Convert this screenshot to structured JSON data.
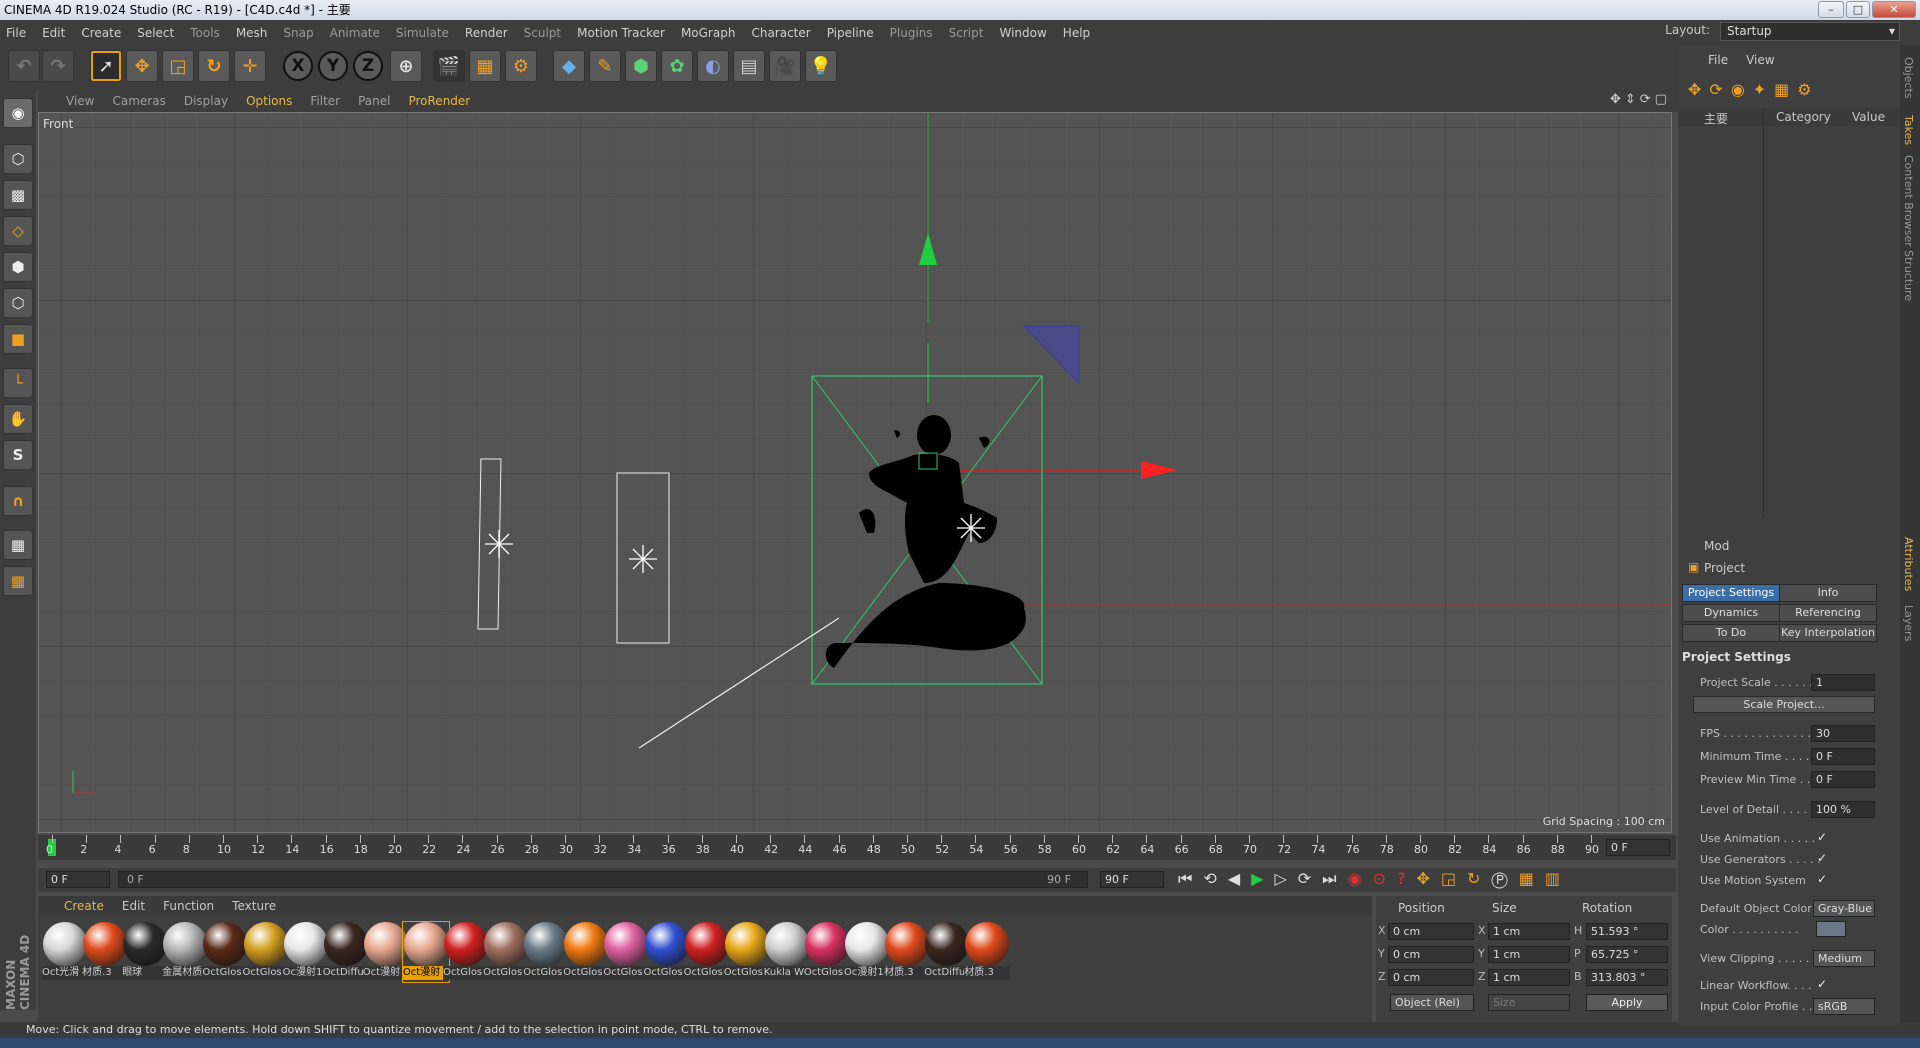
{
  "title": "CINEMA 4D R19.024 Studio (RC - R19) - [C4D.c4d *] - 主要",
  "menu": [
    "File",
    "Edit",
    "Create",
    "Select",
    "Tools",
    "Mesh",
    "Snap",
    "Animate",
    "Simulate",
    "Render",
    "Sculpt",
    "Motion Tracker",
    "MoGraph",
    "Character",
    "Pipeline",
    "Plugins",
    "Script",
    "Window",
    "Help"
  ],
  "layout": {
    "label": "Layout:",
    "value": "Startup"
  },
  "toolbar": {
    "axis_x": "X",
    "axis_y": "Y",
    "axis_z": "Z"
  },
  "viewport": {
    "menu": [
      "View",
      "Cameras",
      "Display",
      "Options",
      "Filter",
      "Panel",
      "ProRender"
    ],
    "active_menu": "Options",
    "name": "Front",
    "grid_spacing": "Grid Spacing : 100 cm"
  },
  "timeline": {
    "ticks": [
      "0",
      "2",
      "4",
      "6",
      "8",
      "10",
      "12",
      "14",
      "16",
      "18",
      "20",
      "22",
      "24",
      "26",
      "28",
      "30",
      "32",
      "34",
      "36",
      "38",
      "40",
      "42",
      "44",
      "46",
      "48",
      "50",
      "52",
      "54",
      "56",
      "58",
      "60",
      "62",
      "64",
      "66",
      "68",
      "70",
      "72",
      "74",
      "76",
      "78",
      "80",
      "82",
      "84",
      "86",
      "88",
      "90"
    ],
    "current": "0 F",
    "start": "0 F",
    "range_left": "0 F",
    "range_right": "90 F",
    "end": "90 F"
  },
  "materials": {
    "menu": [
      "Create",
      "Edit",
      "Function",
      "Texture"
    ],
    "active_menu": "Create",
    "items": [
      {
        "label": "Oct光滑",
        "color": "#d8d8d8"
      },
      {
        "label": "材质.3",
        "color": "#e04a1c"
      },
      {
        "label": "眼球",
        "color": "#2a2a2a"
      },
      {
        "label": "金属材质",
        "color": "#b8b8b8"
      },
      {
        "label": "OctGlos",
        "color": "#5a2a18"
      },
      {
        "label": "OctGlos",
        "color": "#d4a020"
      },
      {
        "label": "Oc漫射1",
        "color": "#e8e8e8"
      },
      {
        "label": "OctDiffu",
        "color": "#3a2620"
      },
      {
        "label": "Oct漫射",
        "color": "#e8a890"
      },
      {
        "label": "Oct漫射",
        "color": "#e8a890"
      },
      {
        "label": "OctGlos",
        "color": "#d02020"
      },
      {
        "label": "OctGlos",
        "color": "#a07060"
      },
      {
        "label": "OctGlos",
        "color": "#6a7a88"
      },
      {
        "label": "OctGlos",
        "color": "#f07a10"
      },
      {
        "label": "OctGlos",
        "color": "#e060a0"
      },
      {
        "label": "OctGlos",
        "color": "#3050d0"
      },
      {
        "label": "OctGlos",
        "color": "#d02020"
      },
      {
        "label": "OctGlos",
        "color": "#e8a818"
      },
      {
        "label": "Kukla W",
        "color": "#d0d0d0"
      },
      {
        "label": "OctGlos",
        "color": "#d83060"
      },
      {
        "label": "Oc漫射1",
        "color": "#e8e8e8"
      },
      {
        "label": "材质.3",
        "color": "#e04a1c"
      },
      {
        "label": "OctDiffu",
        "color": "#3a2620"
      },
      {
        "label": "材质.3",
        "color": "#e04a1c"
      }
    ],
    "selected_index": 9
  },
  "coords": {
    "headers": [
      "Position",
      "Size",
      "Rotation"
    ],
    "position": [
      {
        "axis": "X",
        "value": "0 cm"
      },
      {
        "axis": "Y",
        "value": "0 cm"
      },
      {
        "axis": "Z",
        "value": "0 cm"
      }
    ],
    "size": [
      {
        "axis": "X",
        "value": "1 cm"
      },
      {
        "axis": "Y",
        "value": "1 cm"
      },
      {
        "axis": "Z",
        "value": "1 cm"
      }
    ],
    "rotation": [
      {
        "axis": "H",
        "value": "51.593 °"
      },
      {
        "axis": "P",
        "value": "65.725 °"
      },
      {
        "axis": "B",
        "value": "313.803 °"
      }
    ],
    "mode": "Object (Rel)",
    "size_mode": "Size",
    "apply": "Apply"
  },
  "status": "Move: Click and drag to move elements. Hold down SHIFT to quantize movement / add to the selection in point mode, CTRL to remove.",
  "objects": {
    "menu": [
      "File",
      "View"
    ],
    "columns": {
      "name": "主要",
      "category": "Category",
      "value": "Value"
    }
  },
  "attributes": {
    "mode": "Mod",
    "object": "Project",
    "tabs": [
      "Project Settings",
      "Info",
      "Dynamics",
      "Referencing",
      "To Do",
      "Key Interpolation"
    ],
    "section": "Project Settings",
    "rows": [
      {
        "label": "Project Scale . . . . . .",
        "value": "1"
      },
      {
        "label": "FPS . . . . . . . . . . . . . .",
        "value": "30"
      },
      {
        "label": "Minimum Time . . . . .",
        "value": "0 F"
      },
      {
        "label": "Preview Min Time . . .",
        "value": "0 F"
      },
      {
        "label": "Level of Detail . . . . . .",
        "value": "100 %"
      }
    ],
    "scale_button": "Scale Project...",
    "checks": [
      {
        "label": "Use Animation . . . . .",
        "value": "✓"
      },
      {
        "label": "Use Generators . . . . .",
        "value": "✓"
      },
      {
        "label": "Use Motion System",
        "value": "✓"
      }
    ],
    "default_color_label": "Default Object Color",
    "default_color_value": "Gray-Blue",
    "color_label": "Color . . . . . . . . . .",
    "view_clipping_label": "View Clipping . . . . . .",
    "view_clipping_value": "Medium",
    "linear_workflow_label": "Linear Workflow. . . .",
    "linear_workflow_value": "✓",
    "input_color_label": "Input Color Profile . . .",
    "input_color_value": "sRGB"
  },
  "side_tabs": [
    "Objects",
    "Takes",
    "Content Browser",
    "Structure",
    "Attributes",
    "Layers"
  ],
  "brand": "MAXON CINEMA 4D"
}
